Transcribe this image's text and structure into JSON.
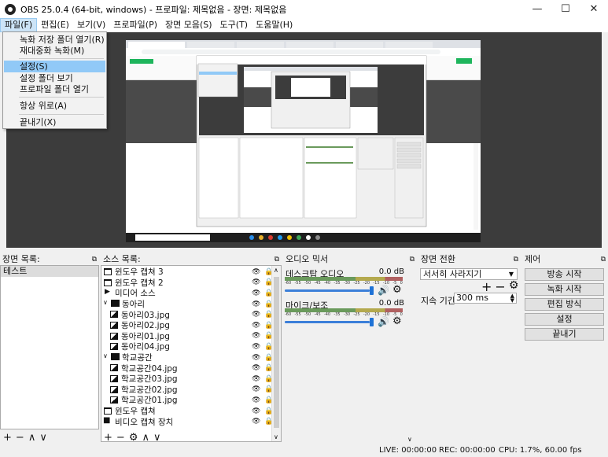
{
  "window": {
    "title": "OBS 25.0.4 (64-bit, windows) - 프로파일: 제목없음 - 장면: 제목없음",
    "minimize": "—",
    "maximize": "☐",
    "close": "✕"
  },
  "menubar": {
    "items": [
      "파일(F)",
      "편집(E)",
      "보기(V)",
      "프로파일(P)",
      "장면 모음(S)",
      "도구(T)",
      "도움말(H)"
    ]
  },
  "file_menu": {
    "items": [
      {
        "label": "녹화 저장 폴더 열기(R)"
      },
      {
        "label": "재대중화 녹화(M)"
      },
      {
        "label": "설정(S)",
        "highlighted": true
      },
      {
        "label": "설정 폴더 보기"
      },
      {
        "label": "프로파일 폴더 열기"
      },
      {
        "label": "항상 위로(A)"
      },
      {
        "label": "끝내기(X)"
      }
    ]
  },
  "scenes_dock": {
    "title": "장면 목록:",
    "items": [
      "테스트"
    ],
    "toolbar": [
      "+",
      "−",
      "∧",
      "∨"
    ]
  },
  "sources_dock": {
    "title": "소스 목록:",
    "items": [
      {
        "label": "윈도우 캡쳐 3",
        "icon": "window-icon",
        "indent": 0
      },
      {
        "label": "윈도우 캡쳐 2",
        "icon": "window-icon",
        "indent": 0
      },
      {
        "label": "미디어 소스",
        "icon": "play-icon",
        "indent": 0
      },
      {
        "label": "동아리",
        "icon": "folder-icon",
        "indent": 0,
        "group": true
      },
      {
        "label": "동아리03.jpg",
        "icon": "image-icon",
        "indent": 1
      },
      {
        "label": "동아리02.jpg",
        "icon": "image-icon",
        "indent": 1
      },
      {
        "label": "동아리01.jpg",
        "icon": "image-icon",
        "indent": 1
      },
      {
        "label": "동아리04.jpg",
        "icon": "image-icon",
        "indent": 1
      },
      {
        "label": "학교공간",
        "icon": "folder-icon",
        "indent": 0,
        "group": true
      },
      {
        "label": "학교공간04.jpg",
        "icon": "image-icon",
        "indent": 1
      },
      {
        "label": "학교공간03.jpg",
        "icon": "image-icon",
        "indent": 1
      },
      {
        "label": "학교공간02.jpg",
        "icon": "image-icon",
        "indent": 1
      },
      {
        "label": "학교공간01.jpg",
        "icon": "image-icon",
        "indent": 1
      },
      {
        "label": "윈도우 캡쳐",
        "icon": "window-icon",
        "indent": 0
      },
      {
        "label": "비디오 캡쳐 장치",
        "icon": "camera-icon",
        "indent": 0
      }
    ],
    "toolbar": [
      "+",
      "−",
      "⚙",
      "∧",
      "∨"
    ]
  },
  "mixer_dock": {
    "title": "오디오 믹서",
    "channels": [
      {
        "name": "데스크탑 오디오",
        "db": "0.0 dB"
      },
      {
        "name": "마이크/보조",
        "db": "0.0 dB"
      }
    ],
    "ticks": [
      "-60",
      "-55",
      "-50",
      "-45",
      "-40",
      "-35",
      "-30",
      "-25",
      "-20",
      "-15",
      "-10",
      "-5",
      "0"
    ]
  },
  "transitions_dock": {
    "title": "장면 전환",
    "selected": "서서히 사라지기",
    "duration_label": "지속 기간",
    "duration_value": "300 ms"
  },
  "controls_dock": {
    "title": "제어",
    "buttons": [
      "방송 시작",
      "녹화 시작",
      "편집 방식",
      "설정",
      "끝내기"
    ]
  },
  "statusbar": {
    "live": "LIVE: 00:00:00",
    "rec": "REC: 00:00:00",
    "cpu": "CPU: 1.7%, 60.00 fps"
  }
}
